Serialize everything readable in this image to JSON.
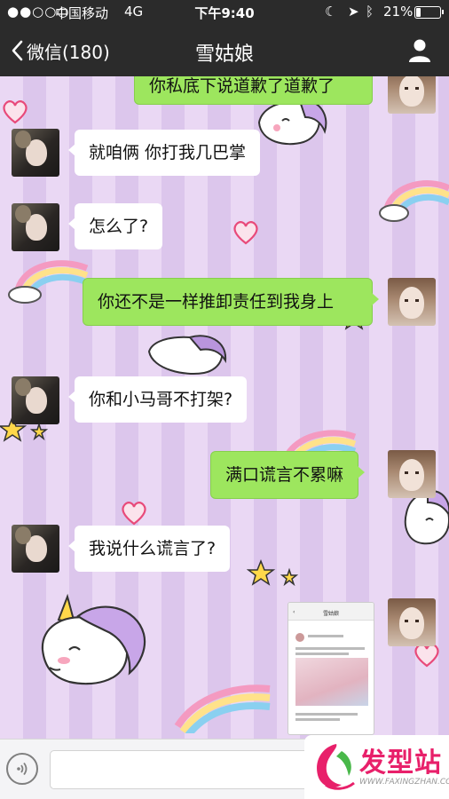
{
  "status_bar": {
    "signal": "●●○○○",
    "carrier": "中国移动",
    "network": "4G",
    "time": "下午9:40",
    "battery_percent": "21%",
    "battery_level": 0.21
  },
  "nav": {
    "back_label": "微信(180)",
    "title": "雪姑娘"
  },
  "messages": [
    {
      "side": "right",
      "text": "你私底下说道歉了道歉了"
    },
    {
      "side": "left",
      "text": "就咱俩 你打我几巴掌"
    },
    {
      "side": "left",
      "text": "怎么了?"
    },
    {
      "side": "right",
      "text": "你还不是一样推卸责任到我身上"
    },
    {
      "side": "left",
      "text": "你和小马哥不打架?"
    },
    {
      "side": "right",
      "text": "满口谎言不累嘛"
    },
    {
      "side": "left",
      "text": "我说什么谎言了?"
    },
    {
      "side": "right",
      "type": "image",
      "text": "雪姑娘"
    }
  ],
  "watermark": {
    "brand": "发型站",
    "url": "WWW.FAXINGZHAN.COM"
  },
  "colors": {
    "bar": "#2b2b2b",
    "bubble_self": "#9de65e",
    "bubble_other": "#ffffff",
    "bg_light": "#ead8f4",
    "bg_dark": "#dcc6ec",
    "watermark": "#e8206a"
  },
  "icons": [
    "back-chevron-icon",
    "profile-icon",
    "voice-icon",
    "moon-icon",
    "location-icon",
    "bluetooth-icon",
    "battery-icon"
  ]
}
